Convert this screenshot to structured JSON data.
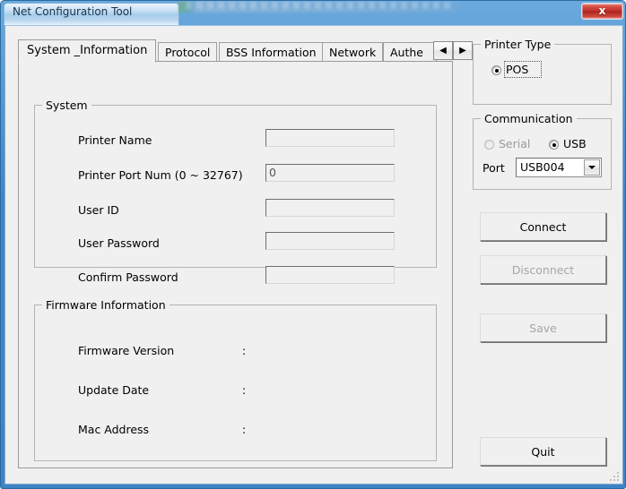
{
  "window": {
    "title": "Net Configuration Tool",
    "close_label": "x",
    "close_icon": "close-icon",
    "accent_color": "#3f87c8",
    "close_color": "#c0302a",
    "client_bg": "#f0f0f0"
  },
  "tabs": {
    "items": [
      {
        "label": "System _Information",
        "selected": true
      },
      {
        "label": "Protocol",
        "selected": false
      },
      {
        "label": "BSS Information",
        "selected": false
      },
      {
        "label": "Network",
        "selected": false
      },
      {
        "label": "Authe",
        "selected": false
      }
    ],
    "scroll_left_icon": "◀",
    "scroll_right_icon": "▶"
  },
  "system_group": {
    "title": "System",
    "fields": [
      {
        "label": "Printer Name",
        "value": "",
        "placeholder": ""
      },
      {
        "label": "Printer Port Num (0 ~ 32767)",
        "value": "0",
        "placeholder": ""
      },
      {
        "label": "User ID",
        "value": "",
        "placeholder": ""
      },
      {
        "label": "User Password",
        "value": "",
        "placeholder": ""
      },
      {
        "label": "Confirm Password",
        "value": "",
        "placeholder": ""
      }
    ]
  },
  "firmware_group": {
    "title": "Firmware Information",
    "separator": ":",
    "rows": [
      {
        "label": "Firmware Version",
        "value": ""
      },
      {
        "label": "Update Date",
        "value": ""
      },
      {
        "label": "Mac Address",
        "value": ""
      }
    ]
  },
  "printer_type": {
    "title": "Printer Type",
    "options": [
      {
        "label": "POS",
        "checked": true,
        "focused": true
      }
    ]
  },
  "communication": {
    "title": "Communication",
    "options": [
      {
        "label": "Serial",
        "checked": false,
        "enabled": false
      },
      {
        "label": "USB",
        "checked": true,
        "enabled": true
      }
    ],
    "port_label": "Port",
    "port_value": "USB004",
    "port_options": [
      "USB004"
    ]
  },
  "actions": {
    "connect": {
      "label": "Connect",
      "enabled": true
    },
    "disconnect": {
      "label": "Disconnect",
      "enabled": false
    },
    "save": {
      "label": "Save",
      "enabled": false
    },
    "quit": {
      "label": "Quit",
      "enabled": true
    }
  }
}
